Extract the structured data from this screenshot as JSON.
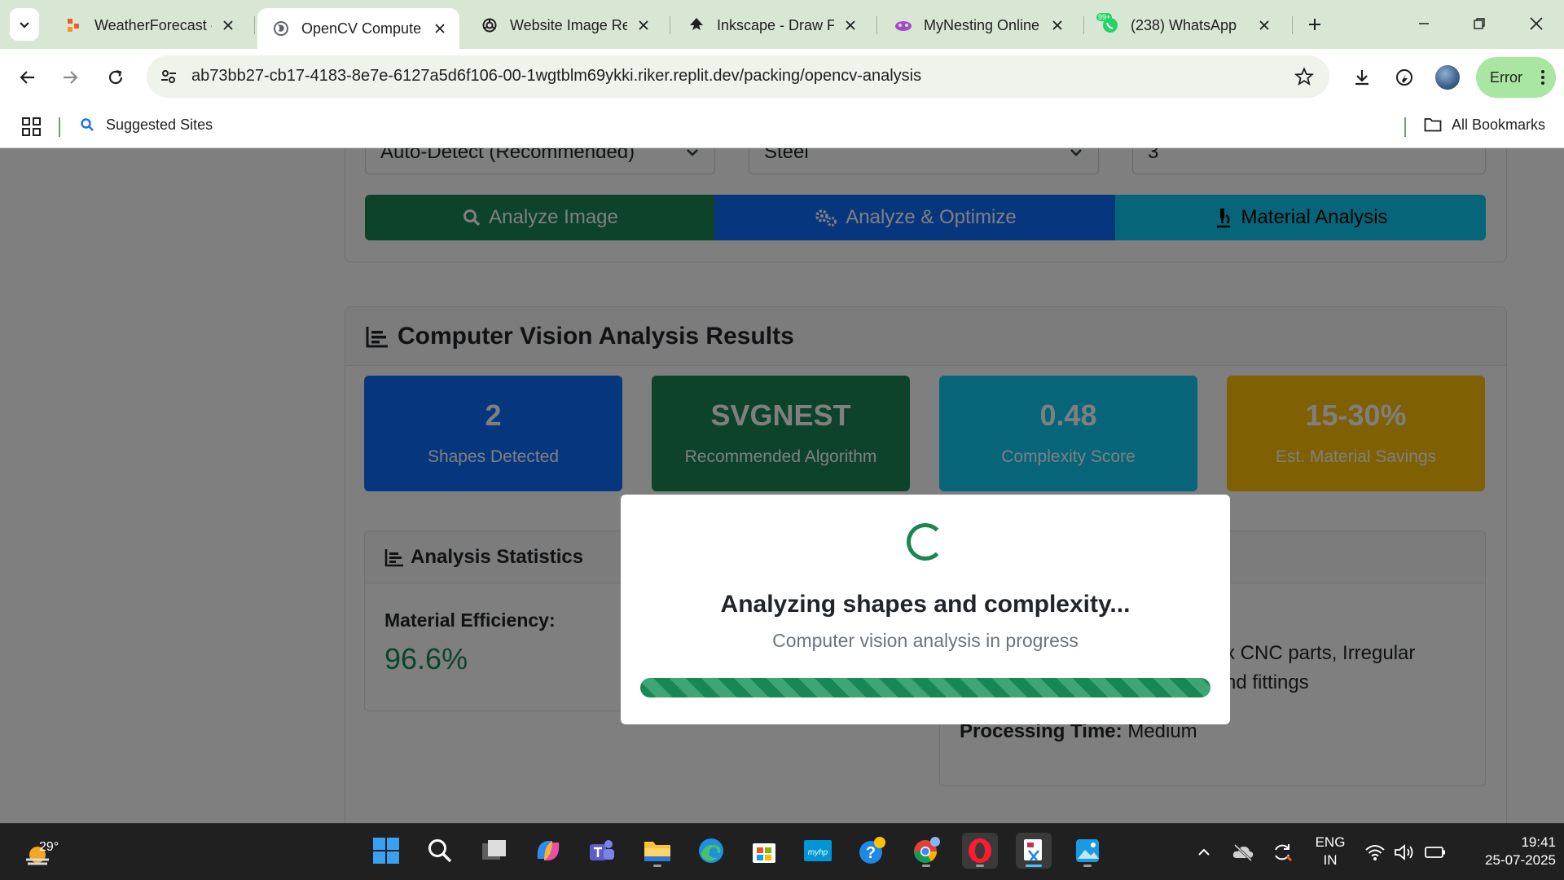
{
  "browser": {
    "tabs": [
      {
        "title": "WeatherForecast -",
        "active": false
      },
      {
        "title": "OpenCV Compute",
        "active": true
      },
      {
        "title": "Website Image Re",
        "active": false
      },
      {
        "title": "Inkscape - Draw Fr",
        "active": false
      },
      {
        "title": "MyNesting Online",
        "active": false
      },
      {
        "title": "(238) WhatsApp",
        "active": false
      }
    ],
    "whatsapp_badge": "99+",
    "url": "ab73bb27-cb17-4183-8e7e-6127a5d6f106-00-1wgtblm69ykki.riker.replit.dev/packing/opencv-analysis",
    "profile_status": "Error",
    "bookmarks": {
      "suggested": "Suggested Sites",
      "all": "All Bookmarks"
    }
  },
  "form": {
    "algorithm_select": "Auto-Detect (Recommended)",
    "material_select": "Steel",
    "quantity_value": "3",
    "buttons": {
      "analyze": "Analyze Image",
      "optimize": "Analyze & Optimize",
      "material": "Material Analysis"
    }
  },
  "results": {
    "title": "Computer Vision Analysis Results",
    "stats": [
      {
        "value": "2",
        "label": "Shapes Detected",
        "color": "#0d6efd"
      },
      {
        "value": "SVGNEST",
        "label": "Recommended Algorithm",
        "color": "#198754"
      },
      {
        "value": "0.48",
        "label": "Complexity Score",
        "color": "#0dcaf0"
      },
      {
        "value": "15-30%",
        "label": "Est. Material Savings",
        "color": "#ffc107"
      }
    ],
    "analysis_statistics": {
      "title": "Analysis Statistics",
      "efficiency_label": "Material Efficiency:",
      "efficiency_value": "96.6%"
    },
    "recommendation": {
      "line1": "x CNC parts, Irregular",
      "line2": "nd fittings",
      "processing_label": "Processing Time:",
      "processing_value": "Medium"
    }
  },
  "loading_modal": {
    "title": "Analyzing shapes and complexity...",
    "subtitle": "Computer vision analysis in progress",
    "progress": 1.0
  },
  "taskbar": {
    "temperature": "29°",
    "language_line1": "ENG",
    "language_line2": "IN",
    "time": "19:41",
    "date": "25-07-2025"
  },
  "colors": {
    "primary": "#0d6efd",
    "success": "#198754",
    "info": "#0dcaf0",
    "warning": "#ffc107",
    "chrome_green": "#d8e6d4"
  }
}
